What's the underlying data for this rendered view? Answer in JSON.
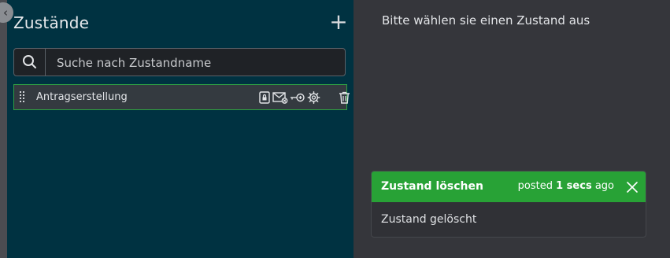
{
  "states_panel": {
    "title": "Zustände",
    "add_label": "+",
    "search": {
      "placeholder": "Suche nach Zustandname",
      "value": ""
    },
    "items": [
      {
        "label": "Antragserstellung",
        "icons": [
          "lock-icon",
          "mail-icon",
          "key-icon",
          "settings-icon",
          "trash-icon"
        ]
      }
    ]
  },
  "detail": {
    "placeholder_text": "Bitte wählen sie einen Zustand aus"
  },
  "toast": {
    "title": "Zustand löschen",
    "time_prefix": "posted",
    "time_value": "1 secs",
    "time_suffix": "ago",
    "message": "Zustand gelöscht",
    "header_color": "#28a236"
  },
  "colors": {
    "panel_bg": "#003241",
    "page_bg": "#35363b",
    "item_border": "#2ea043"
  }
}
